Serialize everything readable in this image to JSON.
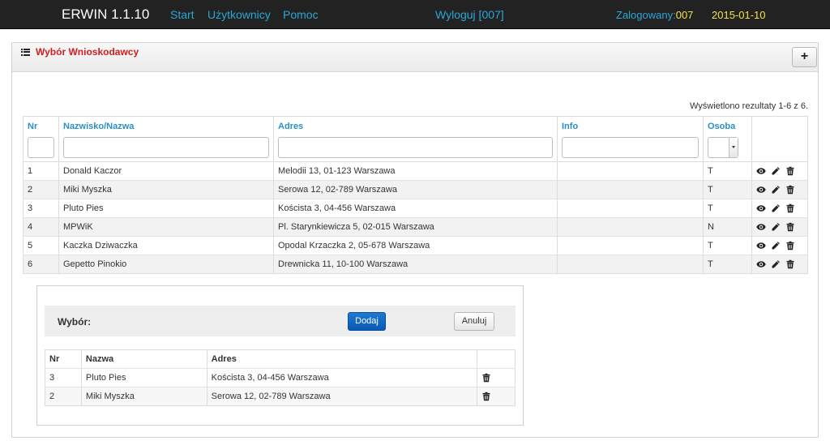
{
  "navbar": {
    "brand": "ERWIN 1.1.10",
    "links": [
      "Start",
      "Użytkownicy",
      "Pomoc"
    ],
    "logout": "Wyloguj [007]",
    "logged_label": "Zalogowany:",
    "logged_user": "007",
    "date": "2015-01-10",
    "colors": {
      "link": "#2aa8d8",
      "highlight": "#f2e24a",
      "background": "#222222"
    }
  },
  "panel": {
    "title": "Wybór Wnioskodawcy",
    "title_icon": "list-icon",
    "add_label": "+",
    "results_info": "Wyświetlono rezultaty 1-6 z 6."
  },
  "table": {
    "headers": [
      "Nr",
      "Nazwisko/Nazwa",
      "Adres",
      "Info",
      "Osoba"
    ],
    "filters": {
      "nr": "",
      "nazwa": "",
      "adres": "",
      "info": "",
      "osoba": ""
    },
    "row_action_icons": [
      "eye-icon",
      "pencil-icon",
      "trash-icon"
    ],
    "rows": [
      {
        "nr": "1",
        "nazwa": "Donald Kaczor",
        "adres": "Melodii 13, 01-123 Warszawa",
        "info": "",
        "osoba": "T"
      },
      {
        "nr": "2",
        "nazwa": "Miki Myszka",
        "adres": "Serowa 12, 02-789 Warszawa",
        "info": "",
        "osoba": "T"
      },
      {
        "nr": "3",
        "nazwa": "Pluto Pies",
        "adres": "Koścista 3, 04-456 Warszawa",
        "info": "",
        "osoba": "T"
      },
      {
        "nr": "4",
        "nazwa": "MPWiK",
        "adres": "Pl. Starynkiewicza 5, 02-015 Warszawa",
        "info": "",
        "osoba": "N"
      },
      {
        "nr": "5",
        "nazwa": "Kaczka Dziwaczka",
        "adres": "Opodal Krzaczka 2, 05-678 Warszawa",
        "info": "",
        "osoba": "T"
      },
      {
        "nr": "6",
        "nazwa": "Gepetto Pinokio",
        "adres": "Drewnicka 11, 10-100 Warszawa",
        "info": "",
        "osoba": "T"
      }
    ]
  },
  "selection": {
    "label": "Wybór:",
    "add_button": "Dodaj",
    "cancel_button": "Anuluj",
    "headers": [
      "Nr",
      "Nazwa",
      "Adres"
    ],
    "rows": [
      {
        "nr": "3",
        "nazwa": "Pluto Pies",
        "adres": "Koścista 3, 04-456 Warszawa"
      },
      {
        "nr": "2",
        "nazwa": "Miki Myszka",
        "adres": "Serowa 12, 02-789 Warszawa"
      }
    ]
  }
}
